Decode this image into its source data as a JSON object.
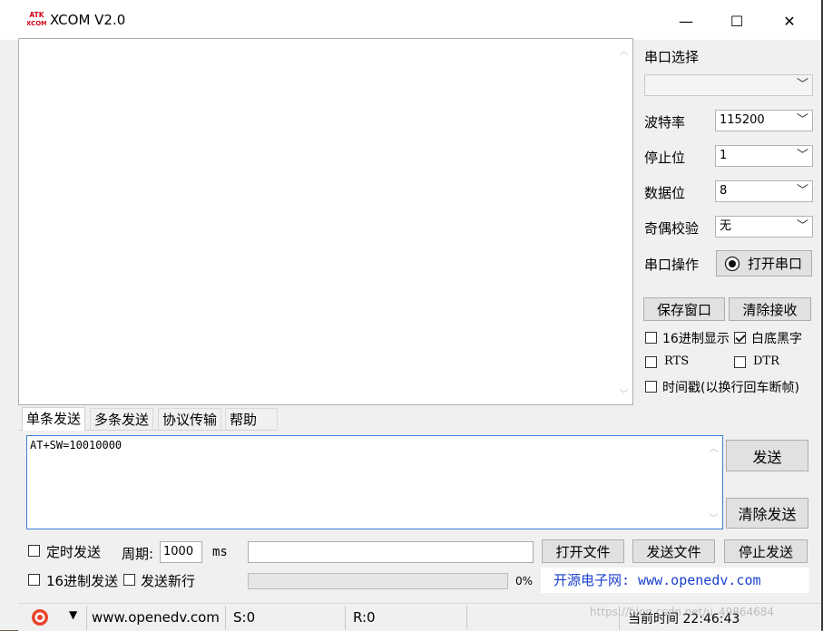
{
  "window": {
    "title": "XCOM V2.0",
    "icon_text": "ATK XCOM",
    "controls": {
      "minimize": "—",
      "maximize": "☐",
      "close": "✕"
    }
  },
  "serial": {
    "port_label": "串口选择",
    "port_value": "",
    "baud_label": "波特率",
    "baud_value": "115200",
    "stop_label": "停止位",
    "stop_value": "1",
    "data_label": "数据位",
    "data_value": "8",
    "parity_label": "奇偶校验",
    "parity_value": "无",
    "op_label": "串口操作",
    "open_button": "打开串口"
  },
  "actions": {
    "save_window": "保存窗口",
    "clear_receive": "清除接收"
  },
  "options": {
    "hex_display": "16进制显示",
    "white_black": "白底黑字",
    "rts": "RTS",
    "dtr": "DTR",
    "timestamp": "时间戳(以换行回车断帧)"
  },
  "tabs": [
    "单条发送",
    "多条发送",
    "协议传输",
    "帮助"
  ],
  "send": {
    "text": "AT+SW=10010000",
    "send_button": "发送",
    "clear_send_button": "清除发送"
  },
  "bottom": {
    "timed_send": "定时发送",
    "period_label": "周期:",
    "period_value": "1000",
    "ms_label": "ms",
    "file_path": "",
    "open_file": "打开文件",
    "send_file": "发送文件",
    "stop_send": "停止发送",
    "hex_send": "16进制发送",
    "send_newline": "发送新行",
    "progress_percent": "0%",
    "progress_value": 0,
    "brand": "开源电子网: www.openedv.com"
  },
  "statusbar": {
    "url": "www.openedv.com",
    "sent": "S:0",
    "received": "R:0",
    "time_label": "当前时间 22:46:43",
    "watermark": "https://blog.csdn.net/u_49864684"
  },
  "colors": {
    "tx_border": "#3c7fd1",
    "brand_text": "#1a3fcf",
    "logo_red": "#d0021b"
  }
}
